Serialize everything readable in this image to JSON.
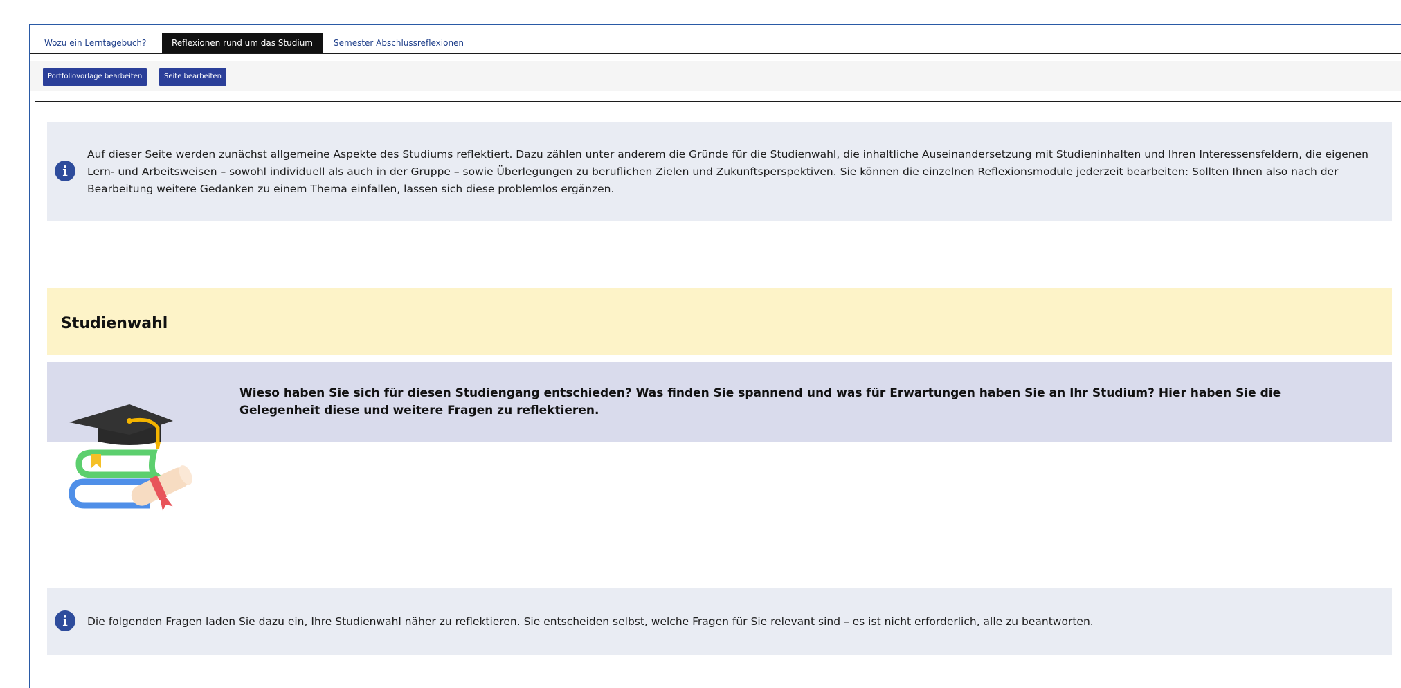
{
  "tabs": [
    {
      "label": "Wozu ein Lerntagebuch?",
      "active": false
    },
    {
      "label": "Reflexionen rund um das Studium",
      "active": true
    },
    {
      "label": "Semester Abschlussreflexionen",
      "active": false
    }
  ],
  "toolbar": {
    "edit_template_label": "Portfoliovorlage bearbeiten",
    "edit_page_label": "Seite bearbeiten"
  },
  "intro": {
    "icon": "info-icon",
    "text": "Auf dieser Seite werden zunächst allgemeine Aspekte des Studiums reflektiert. Dazu zählen unter anderem die Gründe für die Studienwahl, die inhaltliche Auseinandersetzung mit Studieninhalten und Ihren Interessensfeldern, die eigenen Lern- und Arbeitsweisen – sowohl individuell als auch in der Gruppe – sowie Überlegungen zu beruflichen Zielen und Zukunftsperspektiven. Sie können die einzelnen Reflexionsmodule jederzeit bearbeiten: Sollten Ihnen also nach der Bearbeitung weitere Gedanken zu einem Thema einfallen, lassen sich diese problemlos ergänzen."
  },
  "section": {
    "title": "Studienwahl",
    "question": "Wieso haben Sie sich für diesen Studiengang entschieden? Was finden Sie spannend und was für Erwartungen haben Sie an Ihr Studium? Hier haben Sie die Gelegenheit  diese und weitere Fragen zu reflektieren.",
    "illustration": "graduation-cap-books-icon"
  },
  "note": {
    "icon": "info-icon",
    "text": "Die folgenden Fragen laden Sie dazu ein, Ihre Studienwahl näher zu reflektieren. Sie entscheiden selbst, welche Fragen für Sie relevant sind – es ist nicht erforderlich, alle zu beantworten."
  },
  "colors": {
    "accent": "#2b3f99",
    "info_bg": "#e9ecf3",
    "heading_bg": "#fdf3c8",
    "question_bg": "#d9dbec"
  }
}
